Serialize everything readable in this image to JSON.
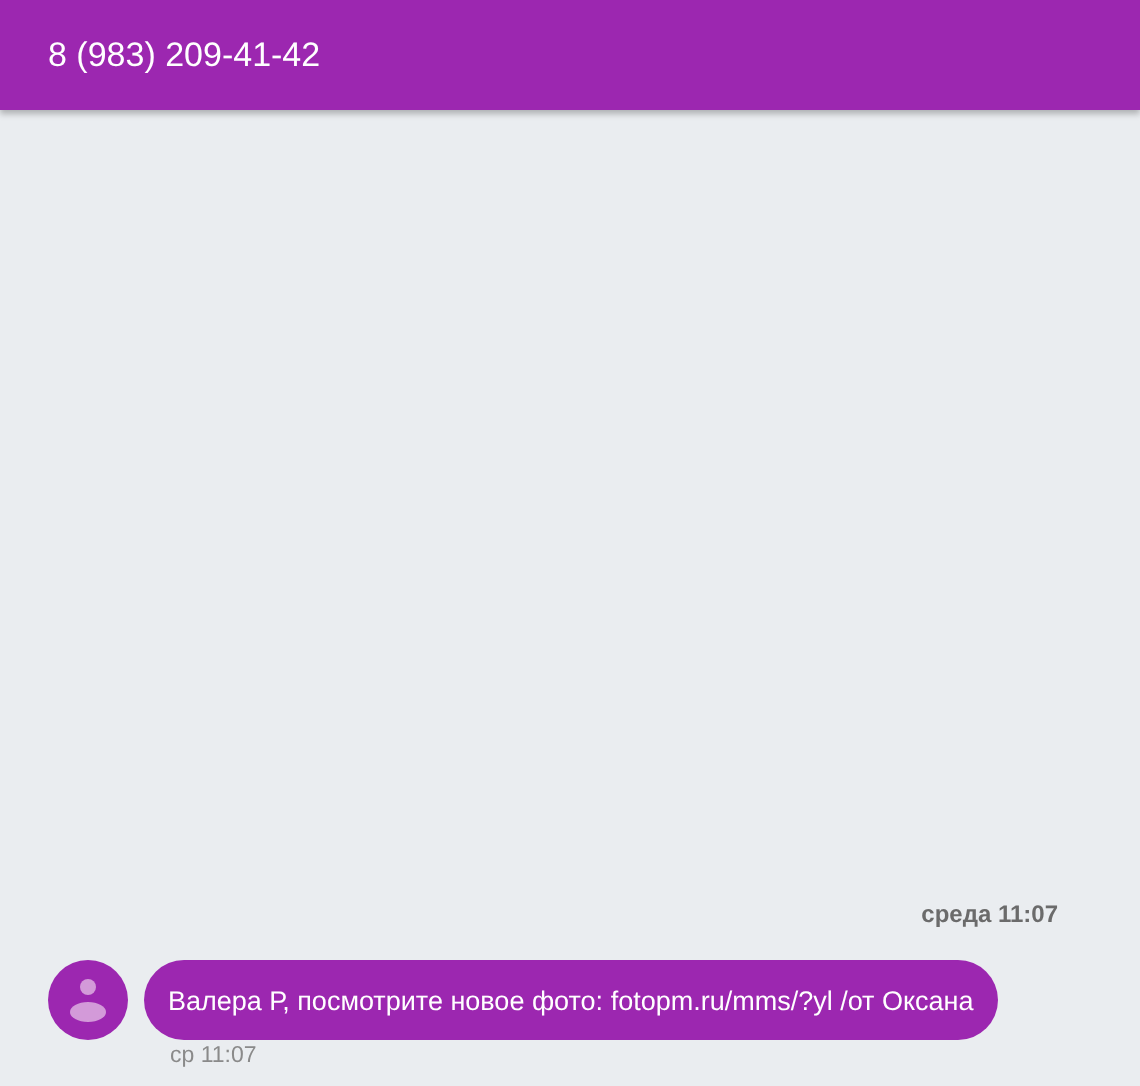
{
  "header": {
    "title": "8 (983) 209-41-42"
  },
  "date_separator": "среда 11:07",
  "messages": [
    {
      "text": "Валера Р, посмотрите новое фото: fotopm.ru/mms/?yl /от Оксана",
      "time": "ср 11:07"
    }
  ]
}
